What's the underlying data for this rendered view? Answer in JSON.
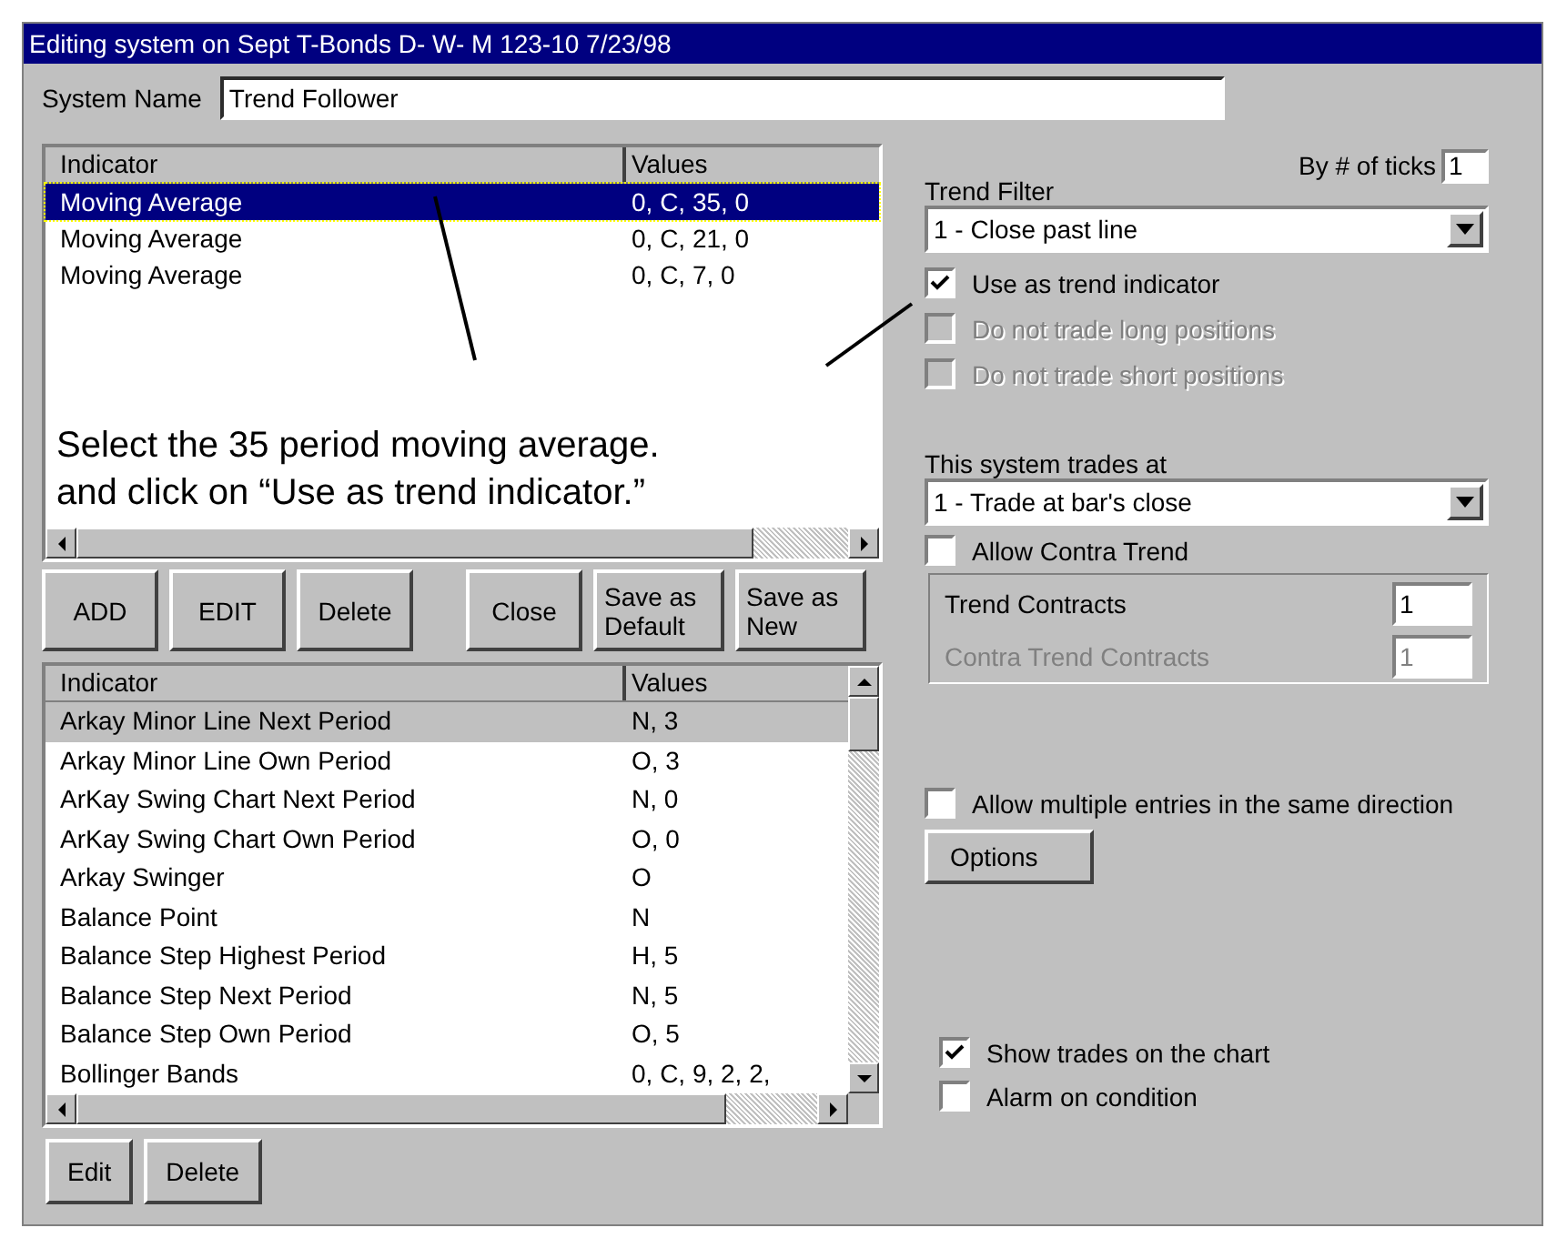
{
  "window": {
    "title": "Editing system on Sept T-Bonds D- W- M  123-10 7/23/98"
  },
  "system_name": {
    "label": "System Name",
    "value": "Trend Follower"
  },
  "indicator_list": {
    "columns": [
      "Indicator",
      "Values"
    ],
    "rows": [
      {
        "indicator": "Moving Average",
        "values": "0, C, 35, 0",
        "selected": true
      },
      {
        "indicator": "Moving Average",
        "values": "0, C, 21, 0",
        "selected": false
      },
      {
        "indicator": "Moving Average",
        "values": "0, C, 7, 0",
        "selected": false
      }
    ]
  },
  "annotation": {
    "lines": [
      "Select the 35 period moving average.",
      "and click on “Use as trend indicator.”"
    ]
  },
  "list_buttons": [
    {
      "label": "ADD"
    },
    {
      "label": "EDIT"
    },
    {
      "label": "Delete"
    },
    {
      "label": "Close"
    },
    {
      "label": "Save as Default"
    },
    {
      "label": "Save as New"
    }
  ],
  "available_list": {
    "columns": [
      "Indicator",
      "Values"
    ],
    "rows": [
      {
        "indicator": "Arkay Minor Line Next Period",
        "values": "N, 3",
        "selected": true
      },
      {
        "indicator": "Arkay Minor Line Own Period",
        "values": "O, 3",
        "selected": false
      },
      {
        "indicator": "ArKay Swing Chart Next Period",
        "values": "N, 0",
        "selected": false
      },
      {
        "indicator": "ArKay Swing Chart Own Period",
        "values": "O, 0",
        "selected": false
      },
      {
        "indicator": "Arkay Swinger",
        "values": "O",
        "selected": false
      },
      {
        "indicator": "Balance Point",
        "values": "N",
        "selected": false
      },
      {
        "indicator": "Balance Step Highest Period",
        "values": "H, 5",
        "selected": false
      },
      {
        "indicator": "Balance Step Next Period",
        "values": "N, 5",
        "selected": false
      },
      {
        "indicator": "Balance Step Own Period",
        "values": "O, 5",
        "selected": false
      },
      {
        "indicator": "Bollinger Bands",
        "values": "0, C, 9, 2, 2,",
        "selected": false
      }
    ]
  },
  "bottom_buttons": [
    {
      "label": "Edit"
    },
    {
      "label": "Delete"
    }
  ],
  "by_ticks": {
    "label": "By # of ticks",
    "value": "1"
  },
  "trend_filter": {
    "label": "Trend Filter",
    "value": "1 - Close past line"
  },
  "trend_options": [
    {
      "label": "Use as trend indicator",
      "checked": true,
      "disabled": false
    },
    {
      "label": "Do not trade long positions",
      "checked": false,
      "disabled": true
    },
    {
      "label": "Do not trade short positions",
      "checked": false,
      "disabled": true
    }
  ],
  "trades_at": {
    "label": "This system trades at",
    "value": "1 - Trade at bar's close"
  },
  "allow_contra": {
    "label": "Allow Contra Trend",
    "checked": false
  },
  "contracts": [
    {
      "label": "Trend Contracts",
      "value": "1",
      "disabled": false
    },
    {
      "label": "Contra Trend Contracts",
      "value": "1",
      "disabled": true
    }
  ],
  "allow_multiple": {
    "label": "Allow multiple entries in the same direction",
    "checked": false
  },
  "options_button": {
    "label": "Options"
  },
  "display_options": [
    {
      "label": "Show trades on the chart",
      "checked": true
    },
    {
      "label": "Alarm on condition",
      "checked": false
    }
  ]
}
